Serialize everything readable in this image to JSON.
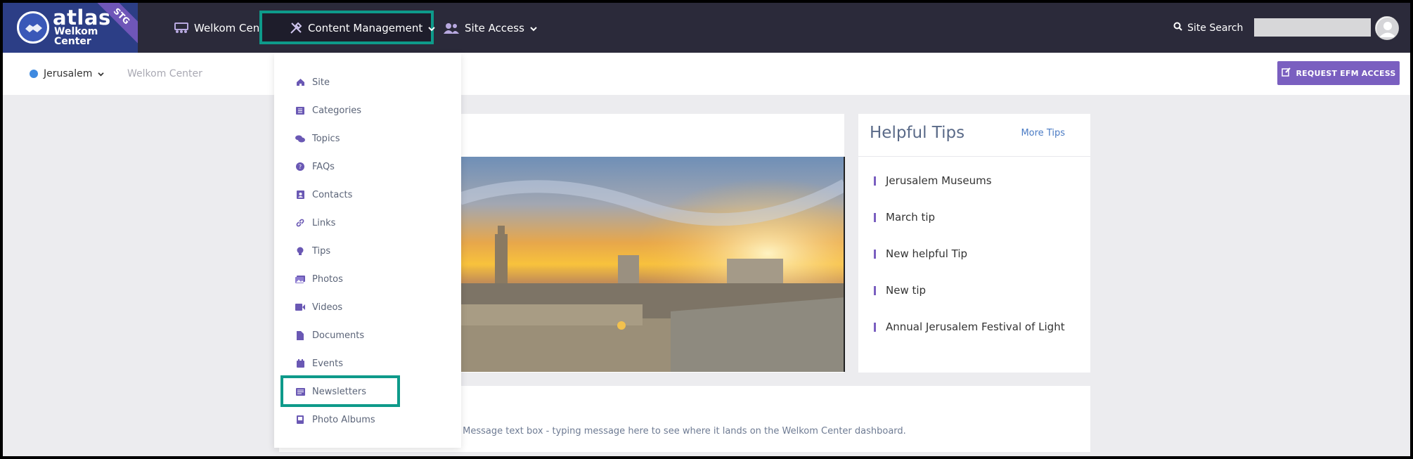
{
  "brand": {
    "name": "atlas",
    "subtitle_line1": "Welkom",
    "subtitle_line2": "Center",
    "env_badge": "STG",
    "colors": {
      "nav_bg": "#2b2a3a",
      "logo_bg": "#2c3e86",
      "accent": "#7a5fc0",
      "highlight": "#0e9a8a"
    }
  },
  "nav": {
    "items": [
      {
        "label": "Welkom Center",
        "icon": "welkom-center-icon"
      },
      {
        "label": "Content Management",
        "icon": "tools-icon",
        "expanded": true
      },
      {
        "label": "Site Access",
        "icon": "users-icon"
      }
    ],
    "site_search": "Site Search"
  },
  "subheader": {
    "location": "Jerusalem",
    "breadcrumb": "Welkom Center",
    "efm_button": "REQUEST EFM ACCESS"
  },
  "dropdown": {
    "items": [
      {
        "label": "Site",
        "icon": "home-icon"
      },
      {
        "label": "Categories",
        "icon": "list-icon"
      },
      {
        "label": "Topics",
        "icon": "comments-icon"
      },
      {
        "label": "FAQs",
        "icon": "question-circle-icon"
      },
      {
        "label": "Contacts",
        "icon": "contact-card-icon"
      },
      {
        "label": "Links",
        "icon": "link-icon"
      },
      {
        "label": "Tips",
        "icon": "lightbulb-icon"
      },
      {
        "label": "Photos",
        "icon": "images-icon"
      },
      {
        "label": "Videos",
        "icon": "video-icon"
      },
      {
        "label": "Documents",
        "icon": "document-icon"
      },
      {
        "label": "Events",
        "icon": "calendar-icon"
      },
      {
        "label": "Newsletters",
        "icon": "newspaper-icon",
        "highlighted": true
      },
      {
        "label": "Photo Albums",
        "icon": "album-icon"
      }
    ]
  },
  "tips": {
    "title": "Helpful Tips",
    "more_link": "More Tips",
    "items": [
      "Jerusalem Museums",
      "March tip",
      "New helpful Tip",
      "New tip",
      "Annual Jerusalem Festival of Light"
    ]
  },
  "message": {
    "text": "ld. Message text box - typing message here to see where it lands on the Welkom Center dashboard."
  }
}
